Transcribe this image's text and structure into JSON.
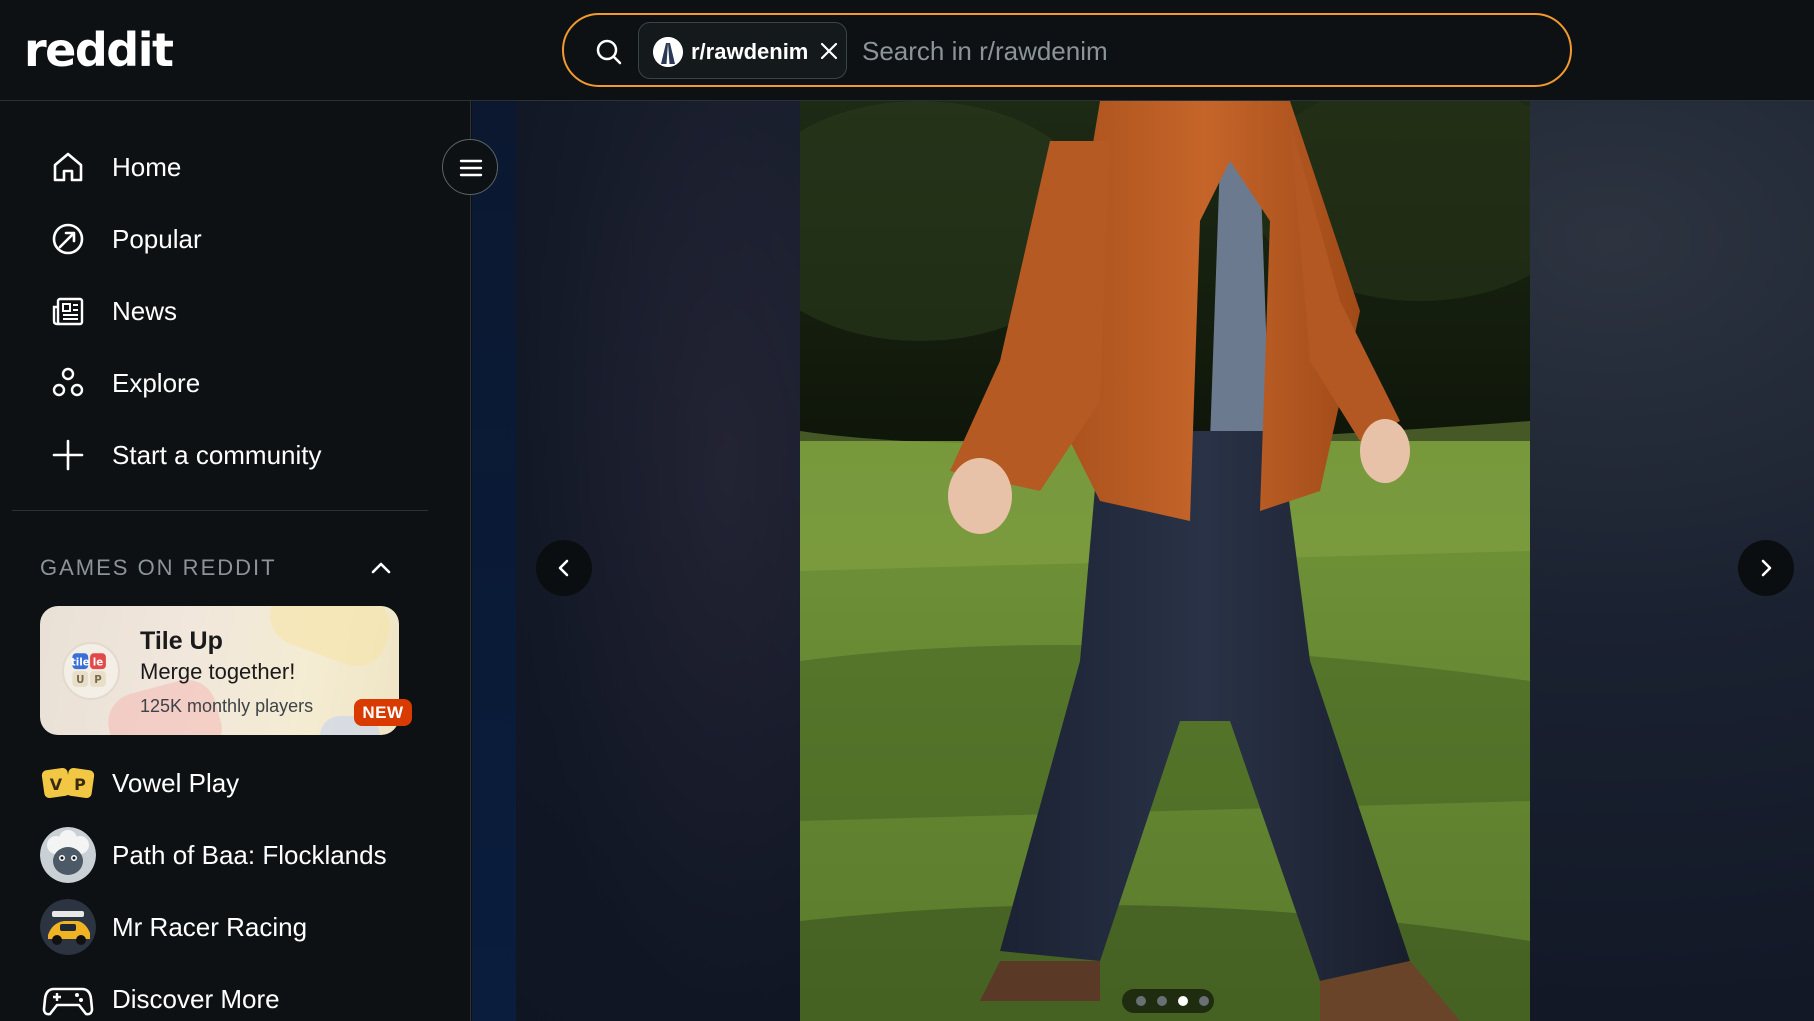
{
  "header": {
    "logo_text": "reddit",
    "search": {
      "chip_label": "r/rawdenim",
      "placeholder": "Search in r/rawdenim"
    }
  },
  "sidebar": {
    "nav": [
      {
        "label": "Home",
        "icon": "home-icon"
      },
      {
        "label": "Popular",
        "icon": "popular-icon"
      },
      {
        "label": "News",
        "icon": "news-icon"
      },
      {
        "label": "Explore",
        "icon": "explore-icon"
      },
      {
        "label": "Start a community",
        "icon": "plus-icon"
      }
    ],
    "games_section": {
      "title": "GAMES ON REDDIT",
      "featured": {
        "title": "Tile Up",
        "subtitle": "Merge together!",
        "players": "125K monthly players",
        "badge": "NEW",
        "icon_text_top": "tile",
        "icon_text_bottom": "UP"
      },
      "games": [
        {
          "label": "Vowel Play",
          "icon": "vowel-play-icon",
          "icon_text": "VP"
        },
        {
          "label": "Path of Baa: Flocklands",
          "icon": "path-of-baa-icon"
        },
        {
          "label": "Mr Racer Racing",
          "icon": "mr-racer-icon"
        },
        {
          "label": "Discover More",
          "icon": "gamepad-icon"
        }
      ]
    }
  },
  "media": {
    "carousel": {
      "total": 4,
      "active_index": 2
    }
  },
  "colors": {
    "accent_search_border": "#f29a2e",
    "new_badge": "#d93a00",
    "background": "#0e1113"
  }
}
